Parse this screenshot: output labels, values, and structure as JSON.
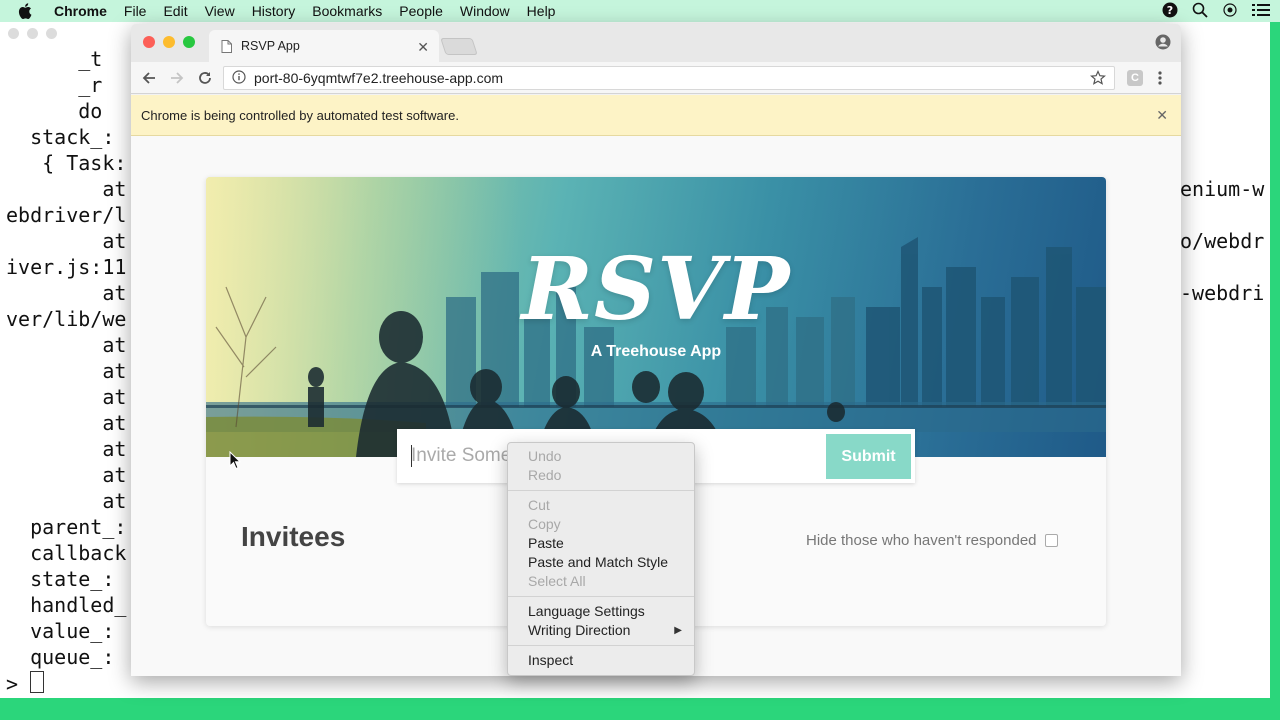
{
  "menubar": {
    "app_name": "Chrome",
    "items": [
      "File",
      "Edit",
      "View",
      "History",
      "Bookmarks",
      "People",
      "Window",
      "Help"
    ]
  },
  "terminal": {
    "lines": [
      "      _t",
      "      _r",
      "      do",
      "  stack_:",
      "   { Task:",
      "        at",
      "ebdriver/l",
      "        at",
      "iver.js:11",
      "        at",
      "ver/lib/we",
      "        at",
      "        at",
      "        at",
      "        at",
      "        at",
      "        at",
      "        at",
      "  parent_:",
      "  callback",
      "  state_:",
      "  handled_",
      "  value_:",
      "  queue_:",
      ">"
    ],
    "right_lines": [
      "enium-w",
      "o/webdr",
      "-webdri"
    ]
  },
  "browser": {
    "tab_title": "RSVP App",
    "url": "port-80-6yqmtwf7e2.treehouse-app.com",
    "infobar_text": "Chrome is being controlled by automated test software."
  },
  "app": {
    "logo": "RSVP",
    "subtitle": "A Treehouse App",
    "invite_placeholder": "Invite Someone",
    "invite_visible_text": "Invite Some",
    "submit_label": "Submit",
    "invitees_title": "Invitees",
    "hide_label": "Hide those who haven't responded"
  },
  "context_menu": {
    "items": [
      {
        "label": "Undo",
        "enabled": false
      },
      {
        "label": "Redo",
        "enabled": false
      },
      {
        "label": "Cut",
        "enabled": false
      },
      {
        "label": "Copy",
        "enabled": false
      },
      {
        "label": "Paste",
        "enabled": true
      },
      {
        "label": "Paste and Match Style",
        "enabled": true
      },
      {
        "label": "Select All",
        "enabled": false
      },
      {
        "label": "Language Settings",
        "enabled": true
      },
      {
        "label": "Writing Direction",
        "enabled": true
      },
      {
        "label": "Inspect",
        "enabled": true
      }
    ]
  },
  "icons": [
    "apple-icon",
    "help-icon",
    "search-icon",
    "siri-icon",
    "list-icon",
    "page-icon",
    "back-arrow-icon",
    "forward-arrow-icon",
    "reload-icon",
    "info-icon",
    "star-icon",
    "extension-icon",
    "kebab-icon",
    "profile-icon",
    "close-icon",
    "mouse-pointer-icon"
  ],
  "colors": {
    "accent": "#88d9c8",
    "infobar": "#fdf3c6",
    "desktop": "#2bd67b"
  }
}
